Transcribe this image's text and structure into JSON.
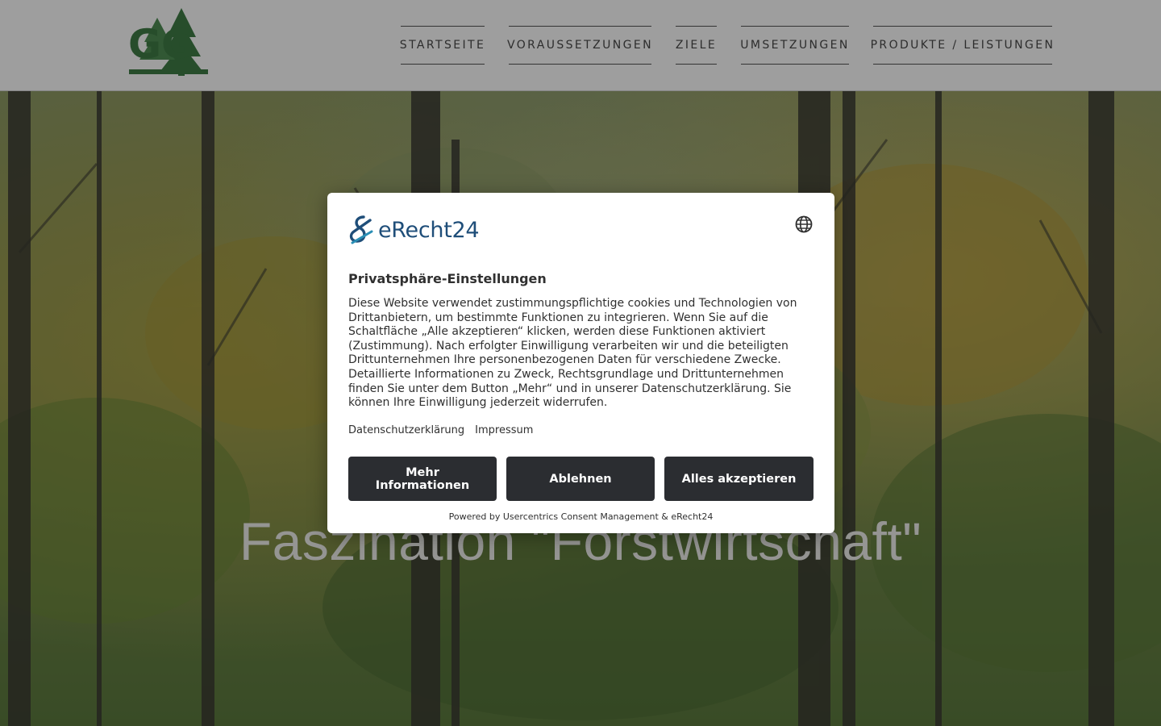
{
  "header": {
    "logo_text": "GG",
    "nav": [
      {
        "label": "STARTSEITE"
      },
      {
        "label": "VORAUSSETZUNGEN"
      },
      {
        "label": "ZIELE"
      },
      {
        "label": "UMSETZUNGEN"
      },
      {
        "label": "PRODUKTE / LEISTUNGEN"
      }
    ]
  },
  "hero": {
    "headline": "Faszination \"Forstwirtschaft\""
  },
  "consent": {
    "brand": "eRecht24",
    "language_icon": "globe-icon",
    "title": "Privatsphäre-Einstellungen",
    "body": "Diese Website verwendet zustimmungspflichtige cookies und Technologien von Drittanbietern, um bestimmte Funktionen zu integrieren. Wenn Sie auf die Schaltfläche „Alle akzeptieren“ klicken, werden diese Funktionen aktiviert (Zustimmung). Nach erfolgter Einwilligung verarbeiten wir und die beteiligten Drittunternehmen Ihre personenbezogenen Daten für verschiedene Zwecke. Detaillierte Informationen zu Zweck, Rechtsgrundlage und Drittunternehmen finden Sie unter dem Button „Mehr“ und in unserer Datenschutzerklärung. Sie können Ihre Einwilligung jederzeit widerrufen.",
    "links": {
      "privacy": "Datenschutzerklärung",
      "imprint": "Impressum"
    },
    "buttons": {
      "more": "Mehr Informationen",
      "deny": "Ablehnen",
      "accept_all": "Alles akzeptieren"
    },
    "powered_by": "Powered by Usercentrics Consent Management & eRecht24"
  },
  "colors": {
    "button_bg": "#2b2d31",
    "brand_blue": "#1f4e79",
    "logo_green": "#3f7d46"
  }
}
